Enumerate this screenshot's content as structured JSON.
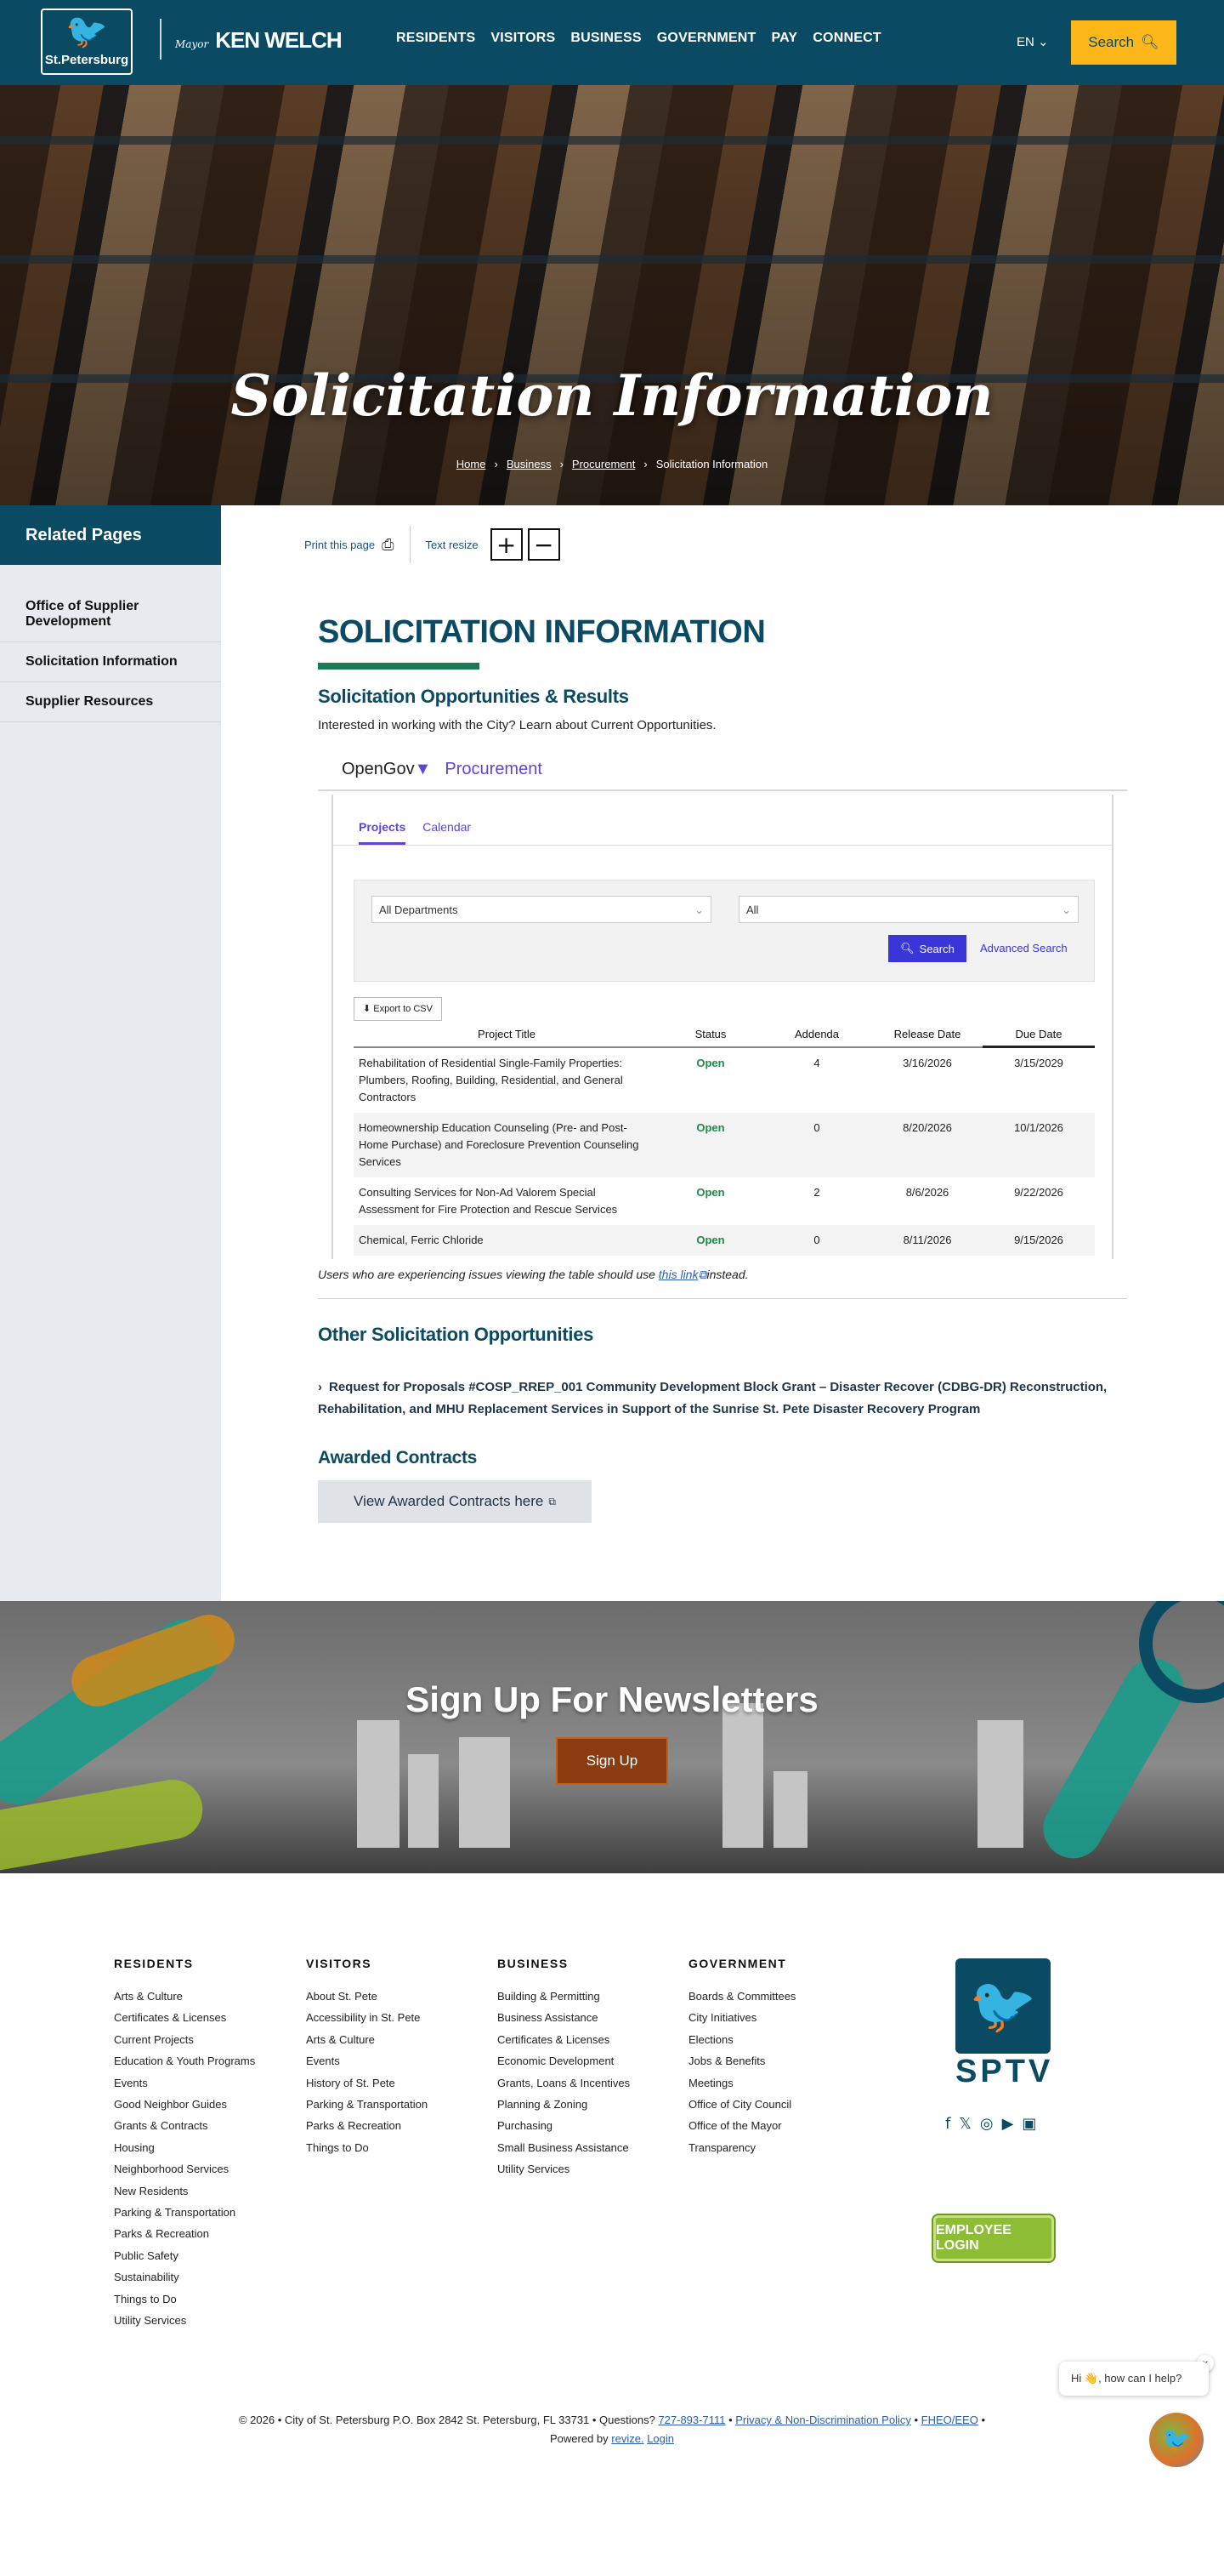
{
  "header": {
    "logo_text": "St.Petersburg",
    "mayor_label": "Mayor",
    "mayor_name": "KEN WELCH",
    "nav": [
      "RESIDENTS",
      "VISITORS",
      "BUSINESS",
      "GOVERNMENT",
      "PAY",
      "CONNECT"
    ],
    "lang": "EN",
    "search_label": "Search"
  },
  "hero": {
    "title": "Solicitation Information",
    "breadcrumb": [
      "Home",
      "Business",
      "Procurement",
      "Solicitation Information"
    ]
  },
  "sidebar": {
    "title": "Related Pages",
    "items": [
      "Office of Supplier Development",
      "Solicitation Information",
      "Supplier Resources"
    ]
  },
  "tools": {
    "print": "Print this page",
    "resize": "Text resize"
  },
  "main": {
    "title": "SOLICITATION INFORMATION",
    "section1_title": "Solicitation Opportunities & Results",
    "section1_text": "Interested in working with the City? Learn about Current Opportunities.",
    "note_pre": "Users who are experiencing issues viewing the table should use",
    "note_link": "this link",
    "note_post": "instead.",
    "section2_title": "Other Solicitation Opportunities",
    "rfp": "Request for Proposals #COSP_RREP_001 Community Development Block Grant – Disaster Recover (CDBG-DR) Reconstruction, Rehabilitation, and MHU Replacement Services in Support of the Sunrise St. Pete Disaster Recovery Program",
    "section3_title": "Awarded Contracts",
    "awarded_button": "View Awarded Contracts here"
  },
  "opengov": {
    "brand": "OpenGov",
    "product": "Procurement",
    "tabs": [
      "Projects",
      "Calendar"
    ],
    "dept_select": "All Departments",
    "status_select": "All",
    "search_btn": "Search",
    "advanced": "Advanced Search",
    "export": "Export to CSV",
    "columns": [
      "Project Title",
      "Status",
      "Addenda",
      "Release Date",
      "Due Date"
    ],
    "rows": [
      {
        "title": "Rehabilitation of Residential Single-Family Properties: Plumbers, Roofing, Building, Residential, and General Contractors",
        "status": "Open",
        "addenda": "4",
        "release": "3/16/2026",
        "due": "3/15/2029"
      },
      {
        "title": "Homeownership Education Counseling (Pre- and Post-Home Purchase) and Foreclosure Prevention Counseling Services",
        "status": "Open",
        "addenda": "0",
        "release": "8/20/2026",
        "due": "10/1/2026"
      },
      {
        "title": "Consulting Services for Non-Ad Valorem Special Assessment for Fire Protection and Rescue Services",
        "status": "Open",
        "addenda": "2",
        "release": "8/6/2026",
        "due": "9/22/2026"
      },
      {
        "title": "Chemical, Ferric Chloride",
        "status": "Open",
        "addenda": "0",
        "release": "8/11/2026",
        "due": "9/15/2026"
      }
    ]
  },
  "newsletter": {
    "title": "Sign Up For Newsletters",
    "button": "Sign Up"
  },
  "footer": {
    "columns": [
      {
        "title": "RESIDENTS",
        "links": [
          "Arts & Culture",
          "Certificates & Licenses",
          "Current Projects",
          "Education & Youth Programs",
          "Events",
          "Good Neighbor Guides",
          "Grants & Contracts",
          "Housing",
          "Neighborhood Services",
          "New Residents",
          "Parking & Transportation",
          "Parks & Recreation",
          "Public Safety",
          "Sustainability",
          "Things to Do",
          "Utility Services"
        ]
      },
      {
        "title": "VISITORS",
        "links": [
          "About St. Pete",
          "Accessibility in St. Pete",
          "Arts & Culture",
          "Events",
          "History of St. Pete",
          "Parking & Transportation",
          "Parks & Recreation",
          "Things to Do"
        ]
      },
      {
        "title": "BUSINESS",
        "links": [
          "Building & Permitting",
          "Business Assistance",
          "Certificates & Licenses",
          "Economic Development",
          "Grants, Loans & Incentives",
          "Planning & Zoning",
          "Purchasing",
          "Small Business Assistance",
          "Utility Services"
        ]
      },
      {
        "title": "GOVERNMENT",
        "links": [
          "Boards & Committees",
          "City Initiatives",
          "Elections",
          "Jobs & Benefits",
          "Meetings",
          "Office of City Council",
          "Office of the Mayor",
          "Transparency"
        ]
      }
    ],
    "sptv": "SPTV",
    "employee_login": "EMPLOYEE LOGIN",
    "chat_text": "Hi 👋, how can I help?",
    "legal_pre": "© 2026  •  City of St. Petersburg P.O. Box 2842 St. Petersburg, FL 33731  •  Questions?",
    "phone": "727-893-7111",
    "privacy": "Privacy & Non-Discrimination Policy",
    "fheo": "FHEO/EEO",
    "powered_pre": "Powered by",
    "powered": "revize.",
    "login": "Login"
  }
}
